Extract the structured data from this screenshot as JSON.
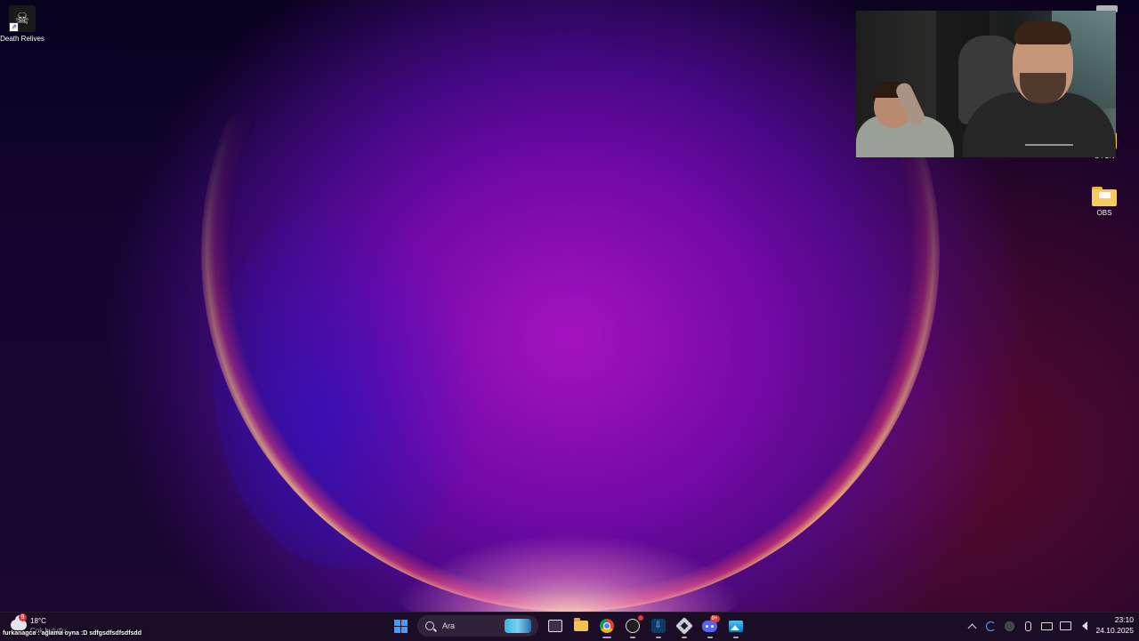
{
  "desktop": {
    "icons": [
      {
        "label": "Death Relives"
      },
      {
        "label": "OYUN"
      },
      {
        "label": "OBS"
      }
    ]
  },
  "webcam_overlay": {
    "present": true
  },
  "taskbar": {
    "weather": {
      "temp": "18°C",
      "condition": "Çok bulutlu",
      "badge": "9"
    },
    "search_placeholder": "Ara",
    "apps": [
      {
        "name": "start-icon"
      },
      {
        "name": "task-view-icon"
      },
      {
        "name": "file-explorer-icon"
      },
      {
        "name": "chrome-icon"
      },
      {
        "name": "obs-icon"
      },
      {
        "name": "app-icon"
      },
      {
        "name": "app-icon"
      },
      {
        "name": "discord-icon",
        "badge": "9+"
      },
      {
        "name": "photos-icon"
      }
    ],
    "clock": {
      "time": "23:10",
      "date": "24.10.2025"
    }
  },
  "chat_overlay": {
    "text": "furkanagca : ağlama oyna :D sdfgsdfsdfsdfsdd"
  }
}
